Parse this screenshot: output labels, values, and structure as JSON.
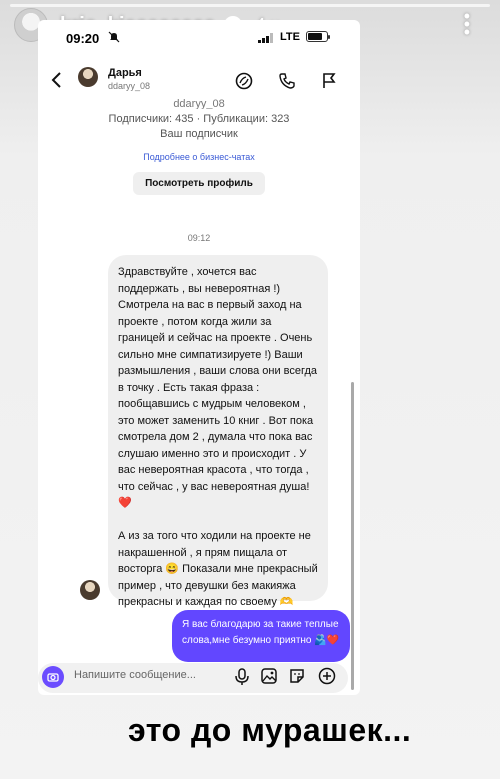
{
  "story": {
    "username": "kris_kissssssss",
    "time_ago": "4 ч.",
    "caption": "это до мурашек..."
  },
  "status_bar": {
    "time": "09:20",
    "network": "LTE"
  },
  "chat_header": {
    "contact_name": "Дарья",
    "contact_handle": "ddaryy_08"
  },
  "profile": {
    "handle": "ddaryy_08",
    "stats": "Подписчики: 435 · Публикации: 323",
    "role": "Ваш подписчик",
    "business_link": "Подробнее о бизнес-чатах",
    "view_profile_button": "Посмотреть профиль"
  },
  "messages": {
    "timestamp": "09:12",
    "incoming_text": "Здравствуйте , хочется вас поддержать , вы невероятная !) Смотрела на вас в первый заход на проекте , потом когда жили за границей и сейчас на проекте . Очень сильно мне симпатизируете !) Ваши размышления , ваши слова они всегда в точку . Есть такая фраза : пообщавшись с мудрым человеком , это может заменить 10 книг . Вот пока смотрела дом 2 , думала что пока вас слушаю именно это и происходит . У вас невероятная красота , что тогда , что сейчас , у вас невероятная душа! ❤️\n\nА из за того что ходили на проекте не накрашенной , я прям пищала от восторга 😄 Показали мне прекрасный пример , что девушки без макияжа прекрасны и каждая по своему 🫶",
    "outgoing_text": "Я вас благодарю за такие теплые слова,мне безумно приятно 🫂❤️"
  },
  "composer": {
    "placeholder": "Напишите сообщение..."
  },
  "colors": {
    "accent": "#6247ff",
    "link": "#3b5bd6",
    "incoming_bubble": "#efefef"
  },
  "icons": [
    "back-icon",
    "video-call-icon",
    "phone-icon",
    "flag-icon",
    "camera-icon",
    "mic-icon",
    "gallery-icon",
    "sticker-icon",
    "plus-icon",
    "verified-icon",
    "mute-icon",
    "signal-icon",
    "battery-icon",
    "more-icon"
  ]
}
